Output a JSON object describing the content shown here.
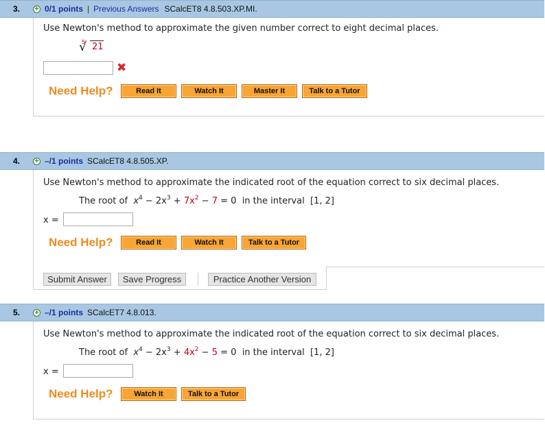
{
  "q3": {
    "number": "3.",
    "points": "0/1 points",
    "separator": "|",
    "previous_answers": "Previous Answers",
    "code": "SCalcET8 4.8.503.XP.MI.",
    "text": "Use Newton's method to approximate the given number correct to eight decimal places.",
    "root_index": "5",
    "radicand": "21",
    "answer_value": "",
    "need_help": "Need Help?",
    "buttons": [
      "Read It",
      "Watch It",
      "Master It",
      "Talk to a Tutor"
    ]
  },
  "q4": {
    "number": "4.",
    "points": "–/1 points",
    "code": "SCalcET8 4.8.505.XP.",
    "text": "Use Newton's method to approximate the indicated root of the equation correct to six decimal places.",
    "eq_prefix": "The root of",
    "eq_x": "x",
    "eq_e1": "4",
    "eq_t2": "− 2x",
    "eq_e2": "3",
    "eq_plus": "+",
    "eq_t3": "7x",
    "eq_e3": "2",
    "eq_minus": "−",
    "eq_c": "7",
    "eq_equals": "= 0",
    "interval_label": "in the interval",
    "interval": "[1, 2]",
    "answer_label": "x =",
    "answer_value": "",
    "need_help": "Need Help?",
    "buttons": [
      "Read It",
      "Watch It",
      "Talk to a Tutor"
    ],
    "actions": [
      "Submit Answer",
      "Save Progress",
      "Practice Another Version"
    ]
  },
  "q5": {
    "number": "5.",
    "points": "–/1 points",
    "code": "SCalcET7 4.8.013.",
    "text": "Use Newton's method to approximate the indicated root of the equation correct to six decimal places.",
    "eq_prefix": "The root of",
    "eq_x": "x",
    "eq_e1": "4",
    "eq_t2": "− 2x",
    "eq_e2": "3",
    "eq_plus": "+",
    "eq_t3": "4x",
    "eq_e3": "2",
    "eq_minus": "−",
    "eq_c": "5",
    "eq_equals": "= 0",
    "interval_label": "in the interval",
    "interval": "[1, 2]",
    "answer_label": "x =",
    "answer_value": "",
    "need_help": "Need Help?",
    "buttons": [
      "Watch It",
      "Talk to a Tutor"
    ]
  },
  "colors": {
    "header_bar": "#a9c7e2",
    "link": "#1a2ea0",
    "need_help": "#f08a1c",
    "help_button": "#f7a535",
    "highlight_red": "#c7001e",
    "wrong_mark": "#d8262c"
  }
}
